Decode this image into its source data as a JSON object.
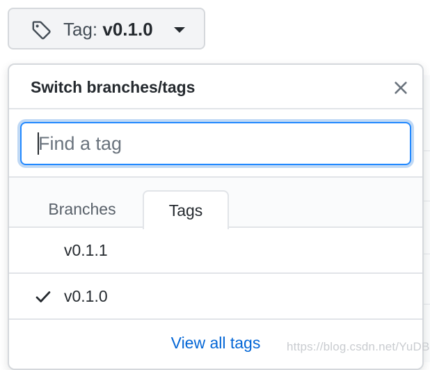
{
  "button": {
    "prefix": "Tag:",
    "ref": "v0.1.0",
    "icon": "tag-icon"
  },
  "dropdown": {
    "title": "Switch branches/tags",
    "close_icon": "close-icon",
    "search": {
      "placeholder": "Find a tag",
      "value": ""
    },
    "tabs": [
      {
        "label": "Branches",
        "selected": false
      },
      {
        "label": "Tags",
        "selected": true
      }
    ],
    "items": [
      {
        "name": "v0.1.1",
        "selected": false
      },
      {
        "name": "v0.1.0",
        "selected": true
      }
    ],
    "footer_link": "View all tags"
  },
  "watermark": "https://blog.csdn.net/YuDBL",
  "colors": {
    "accent": "#0366d6",
    "focus_border": "#2188ff",
    "text": "#24292e",
    "muted": "#586069"
  }
}
